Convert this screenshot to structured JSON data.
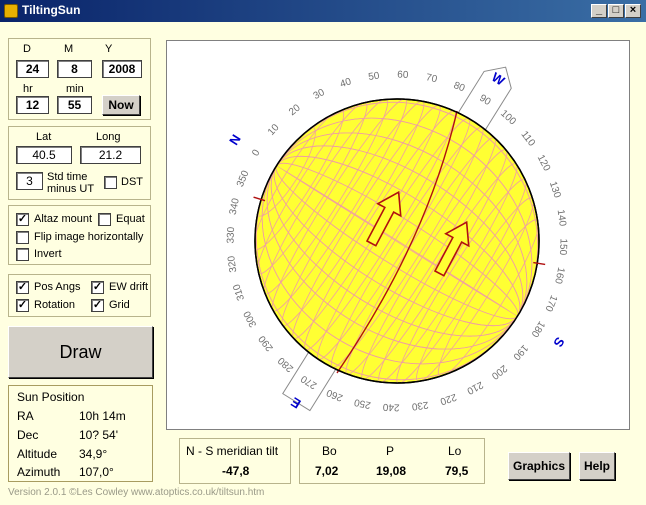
{
  "window": {
    "title": "TiltingSun"
  },
  "date_panel": {
    "d_label": "D",
    "m_label": "M",
    "y_label": "Y",
    "day": "24",
    "month": "8",
    "year": "2008",
    "hr_label": "hr",
    "min_label": "min",
    "hour": "12",
    "minute": "55",
    "now_button": "Now"
  },
  "location_panel": {
    "lat_label": "Lat",
    "long_label": "Long",
    "lat": "40.5",
    "long": "21.2",
    "std_time": "3",
    "std_time_label_1": "Std time",
    "std_time_label_2": "minus UT",
    "dst_label": "DST",
    "dst_checked": false
  },
  "options_panel": {
    "altaz_label": "Altaz mount",
    "altaz_checked": true,
    "equat_label": "Equat",
    "equat_checked": false,
    "flip_label": "Flip image horizontally",
    "flip_checked": false,
    "invert_label": "Invert",
    "invert_checked": false
  },
  "display_panel": {
    "posangs_label": "Pos Angs",
    "posangs_checked": true,
    "ewdrift_label": "EW drift",
    "ewdrift_checked": true,
    "rotation_label": "Rotation",
    "rotation_checked": true,
    "grid_label": "Grid",
    "grid_checked": true
  },
  "draw_button": "Draw",
  "sun_position": {
    "title": "Sun Position",
    "ra_label": "RA",
    "ra_value": "10h 14m",
    "dec_label": "Dec",
    "dec_value": "10? 54'",
    "altitude_label": "Altitude",
    "altitude_value": "34,9°",
    "azimuth_label": "Azimuth",
    "azimuth_value": "107,0°"
  },
  "tilt": {
    "label": "N - S meridian tilt",
    "value": "-47,8"
  },
  "orientation": {
    "bo_label": "Bo",
    "bo_value": "7,02",
    "p_label": "P",
    "p_value": "19,08",
    "lo_label": "Lo",
    "lo_value": "79,5"
  },
  "buttons": {
    "graphics": "Graphics",
    "help": "Help"
  },
  "version": "Version 2.0.1    ©Les Cowley www.atoptics.co.uk/tiltsun.htm",
  "diagram": {
    "compass": {
      "n": "N",
      "s": "S",
      "e": "E",
      "w": "W"
    },
    "angle_labels": [
      "0",
      "10",
      "20",
      "30",
      "40",
      "50",
      "60",
      "70",
      "80",
      "90",
      "100",
      "110",
      "120",
      "130",
      "140",
      "150",
      "160",
      "170",
      "180",
      "190",
      "200",
      "210",
      "220",
      "230",
      "240",
      "250",
      "260",
      "270",
      "280",
      "290",
      "300",
      "310",
      "320",
      "330",
      "340",
      "350"
    ],
    "colors": {
      "sun_fill": "#ffff33",
      "sun_edge": "#e0c000",
      "grid": "#f0a0a0",
      "meridian": "#b01010",
      "compass_letter": "#0000cc",
      "label": "#707070"
    }
  }
}
